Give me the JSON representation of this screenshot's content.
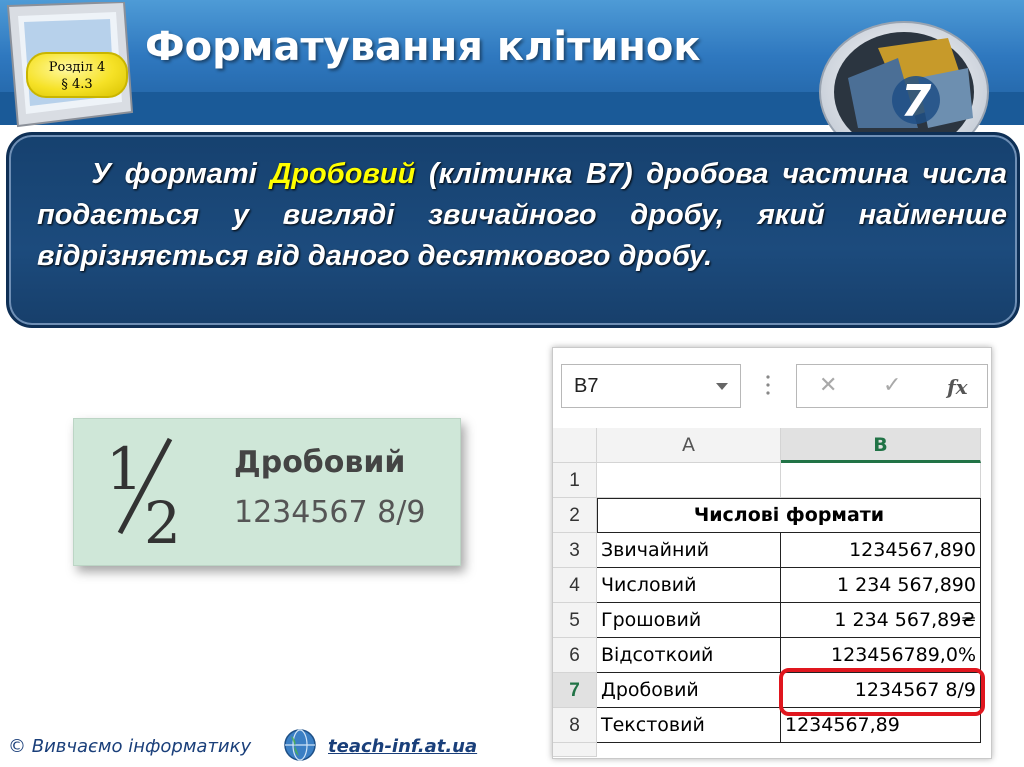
{
  "header": {
    "title": "Форматування клітинок",
    "section_label": "Розділ 4",
    "paragraph_label": "§ 4.3",
    "grade": "7"
  },
  "panel": {
    "text_before": "У форматі ",
    "highlight": "Дробовий",
    "text_after": " (клітинка B7) дробова частина числа подається у вигляді звичайного дробу, який найменше відрізняється від даного десяткового дробу."
  },
  "preview": {
    "icon_glyph": "½",
    "name": "Дробовий",
    "value": "1234567 8/9"
  },
  "excel": {
    "name_box": "B7",
    "col_headers": [
      "A",
      "B"
    ],
    "merged_title": "Числові формати",
    "rows": [
      {
        "num": "1",
        "a": "",
        "b": ""
      },
      {
        "num": "2",
        "merged": true
      },
      {
        "num": "3",
        "a": "Звичайний",
        "b": "1234567,890"
      },
      {
        "num": "4",
        "a": "Числовий",
        "b": "1 234 567,890"
      },
      {
        "num": "5",
        "a": "Грошовий",
        "b": "1 234 567,89₴"
      },
      {
        "num": "6",
        "a": "Відсоткоий",
        "b": "123456789,0%"
      },
      {
        "num": "7",
        "a": "Дробовий",
        "b": "1234567 8/9"
      },
      {
        "num": "8",
        "a": "Текстовий",
        "b": "1234567,89"
      }
    ],
    "formula_buttons": {
      "cancel": "✕",
      "enter": "✓",
      "fx": "fx"
    }
  },
  "footer": {
    "copyright": "© Вивчаємо інформатику",
    "link": "teach-inf.at.ua"
  }
}
